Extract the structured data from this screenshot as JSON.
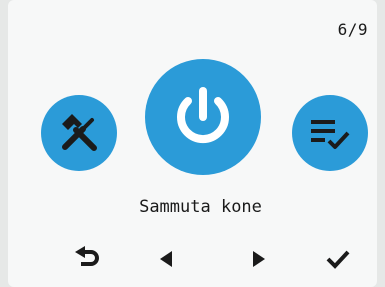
{
  "header": {
    "page_indicator": "6/9"
  },
  "carousel": {
    "items": [
      {
        "icon": "tools-icon",
        "color": "#2b9bd8"
      },
      {
        "icon": "power-icon",
        "color": "#2b9bd8",
        "selected": true
      },
      {
        "icon": "checklist-icon",
        "color": "#2b9bd8"
      }
    ],
    "selected_label": "Sammuta kone"
  },
  "nav": {
    "buttons": [
      "back-icon",
      "previous-icon",
      "next-icon",
      "confirm-icon"
    ]
  }
}
